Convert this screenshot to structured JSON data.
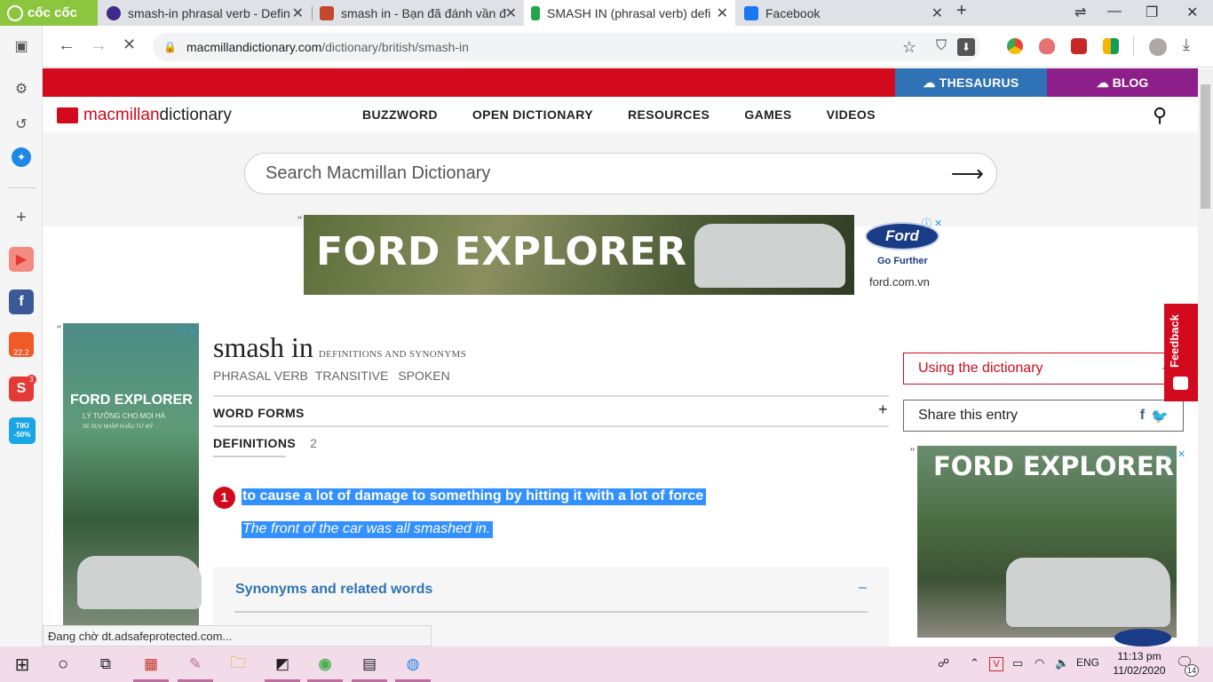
{
  "browser": {
    "brand": "cốc cốc",
    "tabs": [
      {
        "title": "smash-in phrasal verb - Defin",
        "active": false
      },
      {
        "title": "smash in - Bạn đã đánh vần đ",
        "active": false
      },
      {
        "title": "SMASH IN (phrasal verb) defi",
        "active": true
      },
      {
        "title": "Facebook",
        "active": false
      }
    ],
    "url_domain": "macmillandictionary.com",
    "url_path": "/dictionary/british/smash-in",
    "status_text": "Đang chờ dt.adsafeprotected.com...",
    "sidebar_badges": {
      "shopee": "22.2",
      "sendo": "3",
      "tiki": "TIKI -50%"
    }
  },
  "site": {
    "thesaurus_label": "THESAURUS",
    "blog_label": "BLOG",
    "logo_brand": "macmillan",
    "logo_product": " dictionary",
    "nav": [
      "BUZZWORD",
      "OPEN DICTIONARY",
      "RESOURCES",
      "GAMES",
      "VIDEOS"
    ],
    "search_placeholder": "Search Macmillan Dictionary"
  },
  "ads": {
    "top_headline": "FORD EXPLORER",
    "ford_logo": "Ford",
    "ford_tag": "Go Further",
    "ford_url": "ford.com.vn",
    "left_headline": "FORD EXPLORER",
    "left_sub": "LÝ TƯỞNG CHO MỌI HÀ",
    "left_sub2": "XE SUV NHẬP KHẨU TỪ MỸ",
    "right_headline": "FORD EXPLORER"
  },
  "entry": {
    "word": "smash in",
    "defs_and_synonyms": "DEFINITIONS AND SYNONYMS",
    "pos": [
      "PHRASAL VERB",
      "TRANSITIVE",
      "SPOKEN"
    ],
    "word_forms_label": "WORD FORMS",
    "definitions_label": "DEFINITIONS",
    "definitions_count": "2",
    "senses": [
      {
        "number": "1",
        "definition": "to cause a lot of damage to something by hitting it with a lot of force",
        "example": "The front of the car was all smashed in."
      }
    ],
    "synonyms_label": "Synonyms and related words"
  },
  "sidebar": {
    "using_dictionary": "Using the dictionary",
    "share_entry": "Share this entry",
    "feedback": "Feedback"
  },
  "taskbar": {
    "language": "ENG",
    "time": "11:13 pm",
    "date": "11/02/2020",
    "notifications": "14"
  }
}
